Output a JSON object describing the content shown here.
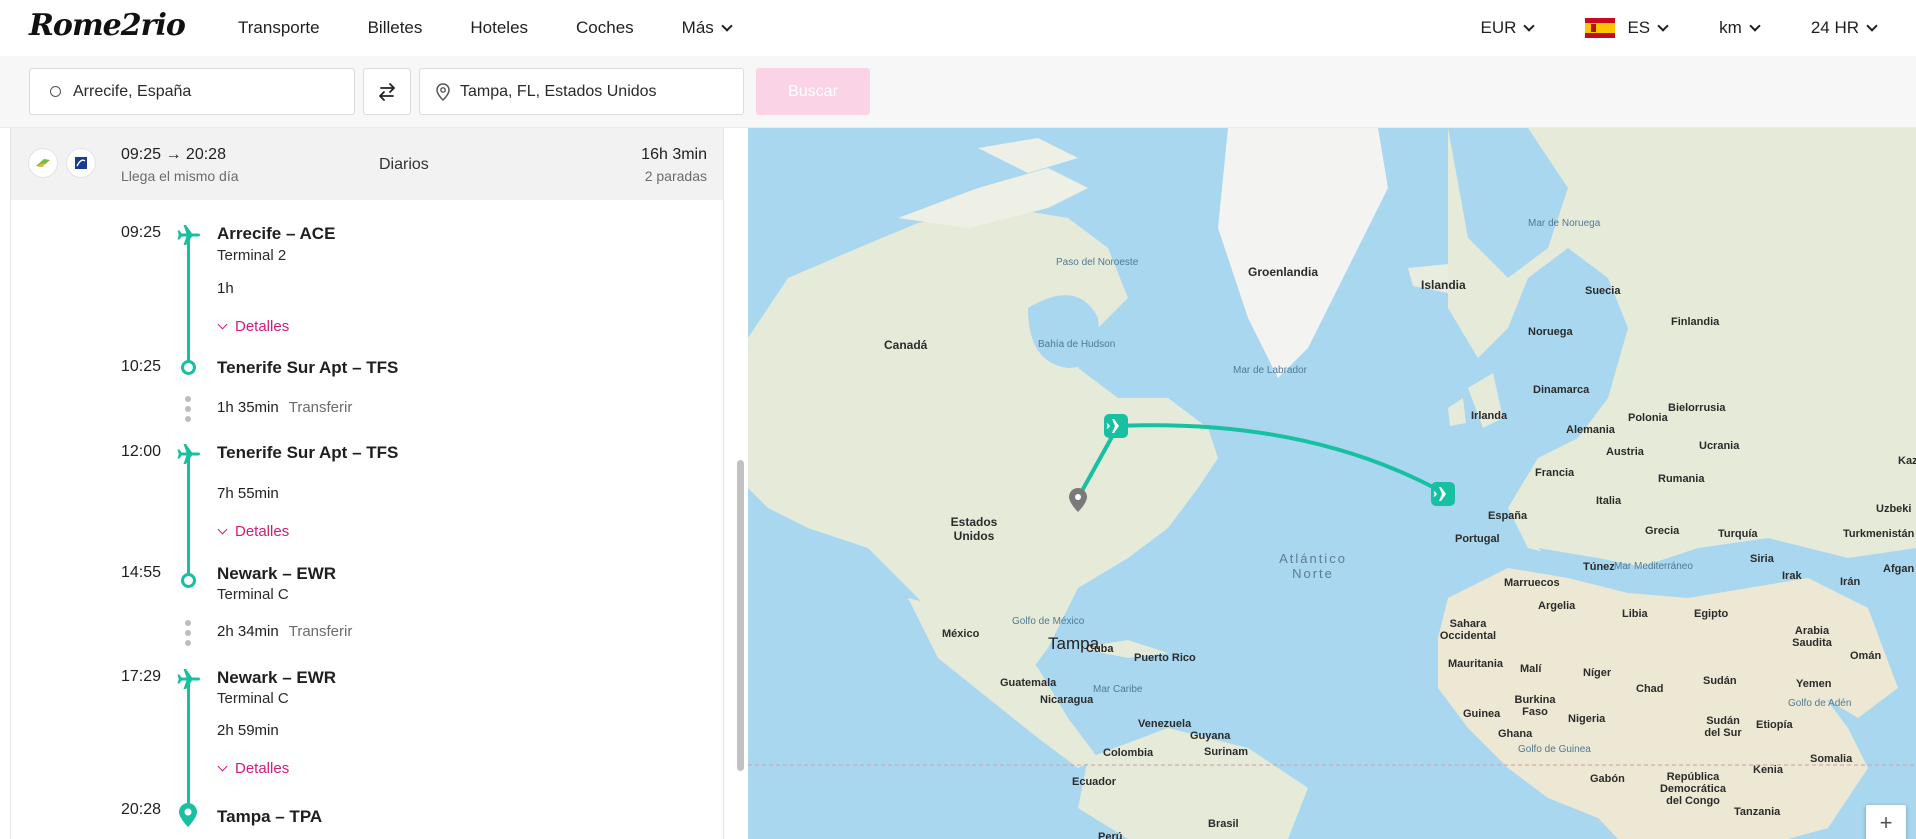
{
  "brand": {
    "logo_text": "Rome2rio"
  },
  "nav": {
    "links": [
      "Transporte",
      "Billetes",
      "Hoteles",
      "Coches",
      "Más"
    ],
    "currency": "EUR",
    "language": "ES",
    "distance_unit": "km",
    "time_format": "24 HR"
  },
  "search": {
    "origin": "Arrecife, España",
    "destination": "Tampa, FL, Estados Unidos",
    "button_label": "Buscar"
  },
  "route_summary": {
    "times": "09:25 → 20:28",
    "arrival_note": "Llega el mismo día",
    "frequency": "Diarios",
    "duration": "16h 3min",
    "stops": "2 paradas"
  },
  "itinerary": {
    "details_label": "Detalles",
    "transfer_label": "Transferir",
    "stops": [
      {
        "time": "09:25",
        "title": "Arrecife – ACE",
        "sub": "Terminal 2"
      },
      {
        "duration": "1h"
      },
      {
        "time": "10:25",
        "title": "Tenerife Sur Apt – TFS"
      },
      {
        "transfer_duration": "1h 35min"
      },
      {
        "time": "12:00",
        "title": "Tenerife Sur Apt – TFS"
      },
      {
        "duration": "7h 55min"
      },
      {
        "time": "14:55",
        "title": "Newark – EWR",
        "sub": "Terminal C"
      },
      {
        "transfer_duration": "2h 34min"
      },
      {
        "time": "17:29",
        "title": "Newark – EWR",
        "sub": "Terminal C"
      },
      {
        "duration": "2h 59min"
      },
      {
        "time": "20:28",
        "title": "Tampa – TPA"
      }
    ]
  },
  "map": {
    "city_label": "Tampa",
    "route_color": "#17c0a0",
    "accent_color": "#d31c78",
    "labels": {
      "groenlandia": "Groenlandia",
      "islandia": "Islandia",
      "canada": "Canadá",
      "paso_noroeste": "Paso del Noroeste",
      "bahia_hudson": "Bahía de Hudson",
      "mar_labrador": "Mar de Labrador",
      "mar_noruega": "Mar de Noruega",
      "suecia": "Suecia",
      "noruega": "Noruega",
      "finlandia": "Finlandia",
      "dinamarca": "Dinamarca",
      "bielorrusia": "Bielorrusia",
      "irlanda": "Irlanda",
      "polonia": "Polonia",
      "alemania": "Alemania",
      "ucrania": "Ucrania",
      "austria": "Austria",
      "francia": "Francia",
      "rumania": "Rumania",
      "italia": "Italia",
      "espana": "España",
      "portugal": "Portugal",
      "grecia": "Grecia",
      "turquia": "Turquía",
      "turkmenistan": "Turkmenistán",
      "uzbekistan": "Uzbeki",
      "kaz": "Kaz",
      "tunez": "Túnez",
      "mar_mediterraneo": "Mar Mediterráneo",
      "siria": "Siria",
      "irak": "Irak",
      "iran": "Irán",
      "afgan": "Afgan",
      "marruecos": "Marruecos",
      "argelia": "Argelia",
      "libia": "Libia",
      "egipto": "Egipto",
      "arabia": "Arabia Saudita",
      "sahara": "Sahara Occidental",
      "mauritania": "Mauritania",
      "mali": "Malí",
      "niger": "Níger",
      "chad": "Chad",
      "sudan": "Sudán",
      "oman": "Omán",
      "yemen": "Yemen",
      "golfo_aden": "Golfo de Adén",
      "guinea": "Guinea",
      "burkina": "Burkina Faso",
      "nigeria": "Nigeria",
      "ghana": "Ghana",
      "sudan_sur": "Sudán del Sur",
      "etiopia": "Etiopía",
      "somalia": "Somalia",
      "golfo_guinea": "Golfo de Guinea",
      "gabon": "Gabón",
      "rdc": "República Democrática del Congo",
      "kenia": "Kenia",
      "tanzania": "Tanzania",
      "atlantico": "Atlántico Norte",
      "estados_unidos": "Estados Unidos",
      "mexico": "México",
      "golfo_mexico": "Golfo de México",
      "cuba": "Cuba",
      "puerto_rico": "Puerto Rico",
      "guatemala": "Guatemala",
      "nicaragua": "Nicaragua",
      "mar_caribe": "Mar Caribe",
      "venezuela": "Venezuela",
      "guyana": "Guyana",
      "surinam": "Surinam",
      "colombia": "Colombia",
      "ecuador": "Ecuador",
      "brasil": "Brasil",
      "peru": "Perú"
    },
    "zoom_in_label": "+"
  }
}
